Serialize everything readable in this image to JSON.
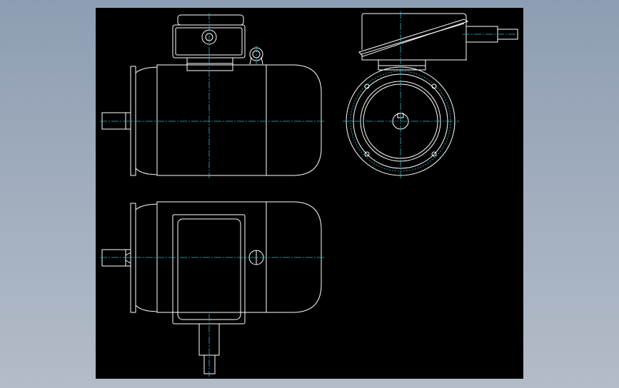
{
  "colors": {
    "background_gradient_top": "#8e9db3",
    "background_gradient_bottom": "#b3bcc8",
    "canvas": "#000000",
    "outline": "#ffffff",
    "centerline": "#2fb8c8"
  },
  "views": [
    "front-view",
    "side-view",
    "top-view"
  ]
}
